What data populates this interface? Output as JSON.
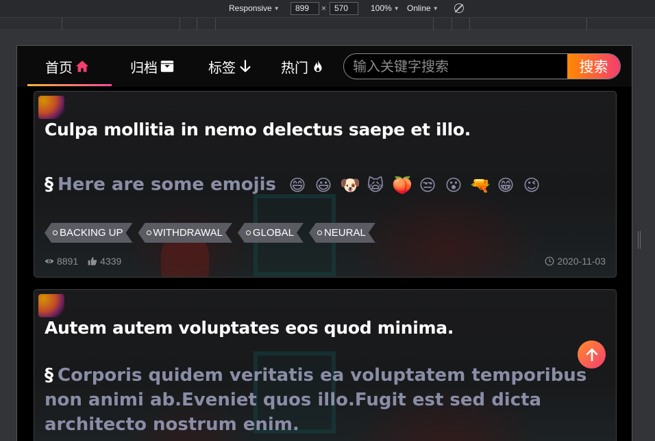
{
  "devtools": {
    "device": "Responsive",
    "width": "899",
    "height": "570",
    "zoom": "100%",
    "network": "Online"
  },
  "nav": {
    "items": [
      {
        "label": "首页",
        "icon": "home-icon",
        "active": true
      },
      {
        "label": "归档",
        "icon": "archive-box-icon",
        "active": false
      },
      {
        "label": "标签",
        "icon": "arrow-down-icon",
        "active": false
      },
      {
        "label": "热门",
        "icon": "fire-icon",
        "active": false
      }
    ],
    "search_placeholder": "输入关键字搜索",
    "search_button": "搜索",
    "accent_gradient": [
      "#f7b733",
      "#fc4a9a"
    ]
  },
  "posts": [
    {
      "title": "Culpa mollitia in nemo delectus saepe et illo.",
      "section_mark": "§",
      "excerpt": "Here are some emojis",
      "emojis": [
        "😄",
        "😃",
        "🐶",
        "🙀",
        "🍑",
        "😒",
        "😮",
        "🔫",
        "😁",
        "😉"
      ],
      "tags": [
        "BACKING UP",
        "WITHDRAWAL",
        "GLOBAL",
        "NEURAL"
      ],
      "views": "8891",
      "likes": "4339",
      "date": "2020-11-03"
    },
    {
      "title": "Autem autem voluptates eos quod minima.",
      "section_mark": "§",
      "excerpt": "Corporis quidem veritatis ea voluptatem temporibus non animi ab.Eveniet quos illo.Fugit est sed dicta architecto nostrum enim."
    }
  ],
  "colors": {
    "page_bg": "#000000",
    "card_border": "#3f3f41",
    "excerpt": "#8b8da6",
    "tag_bg": "#5b5c63",
    "meta": "#8e8e93"
  }
}
